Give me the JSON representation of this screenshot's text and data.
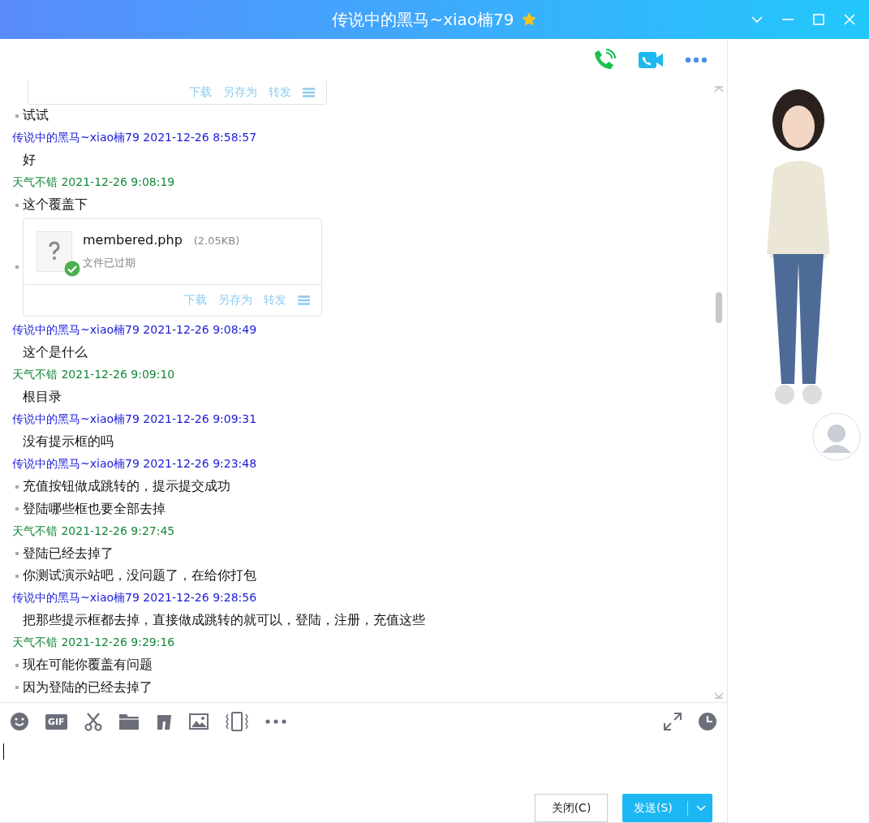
{
  "window": {
    "title": "传说中的黑马~xiao楠79"
  },
  "messages": [
    {
      "kind": "file_partial",
      "actions": [
        "下载",
        "另存为",
        "转发"
      ]
    },
    {
      "kind": "line",
      "text": "试试",
      "bullet": true
    },
    {
      "kind": "header",
      "sender": "传说中的黑马~xiao楠79",
      "time": "2021-12-26 8:58:57",
      "color": "#1a1adb"
    },
    {
      "kind": "line",
      "text": "好",
      "bullet": false
    },
    {
      "kind": "header",
      "sender": "天气不错",
      "time": "2021-12-26 9:08:19",
      "color": "#14883c"
    },
    {
      "kind": "line",
      "text": "这个覆盖下",
      "bullet": true
    },
    {
      "kind": "file",
      "name": "membered.php",
      "size": "(2.05KB)",
      "status": "文件已过期",
      "actions": [
        "下载",
        "另存为",
        "转发"
      ]
    },
    {
      "kind": "header",
      "sender": "传说中的黑马~xiao楠79",
      "time": "2021-12-26 9:08:49",
      "color": "#1a1adb"
    },
    {
      "kind": "line",
      "text": "这个是什么",
      "bullet": false
    },
    {
      "kind": "header",
      "sender": "天气不错",
      "time": "2021-12-26 9:09:10",
      "color": "#14883c"
    },
    {
      "kind": "line",
      "text": "根目录",
      "bullet": false
    },
    {
      "kind": "header",
      "sender": "传说中的黑马~xiao楠79",
      "time": "2021-12-26 9:09:31",
      "color": "#1a1adb"
    },
    {
      "kind": "line",
      "text": "没有提示框的吗",
      "bullet": false
    },
    {
      "kind": "header",
      "sender": "传说中的黑马~xiao楠79",
      "time": "2021-12-26 9:23:48",
      "color": "#1a1adb"
    },
    {
      "kind": "line",
      "text": "充值按钮做成跳转的，提示提交成功",
      "bullet": true
    },
    {
      "kind": "line",
      "text": "登陆哪些框也要全部去掉",
      "bullet": true
    },
    {
      "kind": "header",
      "sender": "天气不错",
      "time": "2021-12-26 9:27:45",
      "color": "#14883c"
    },
    {
      "kind": "line",
      "text": "登陆已经去掉了",
      "bullet": true
    },
    {
      "kind": "line",
      "text": "你测试演示站吧，没问题了，在给你打包",
      "bullet": true
    },
    {
      "kind": "header",
      "sender": "传说中的黑马~xiao楠79",
      "time": "2021-12-26 9:28:56",
      "color": "#1a1adb"
    },
    {
      "kind": "line",
      "text": "把那些提示框都去掉，直接做成跳转的就可以，登陆，注册，充值这些",
      "bullet": false
    },
    {
      "kind": "header",
      "sender": "天气不错",
      "time": "2021-12-26 9:29:16",
      "color": "#14883c"
    },
    {
      "kind": "line",
      "text": "现在可能你覆盖有问题",
      "bullet": true
    },
    {
      "kind": "line",
      "text": "因为登陆的已经去掉了",
      "bullet": true
    }
  ],
  "toolbar": {
    "gif_label": "GIF"
  },
  "buttons": {
    "close": "关闭(C)",
    "send": "发送(S)"
  }
}
